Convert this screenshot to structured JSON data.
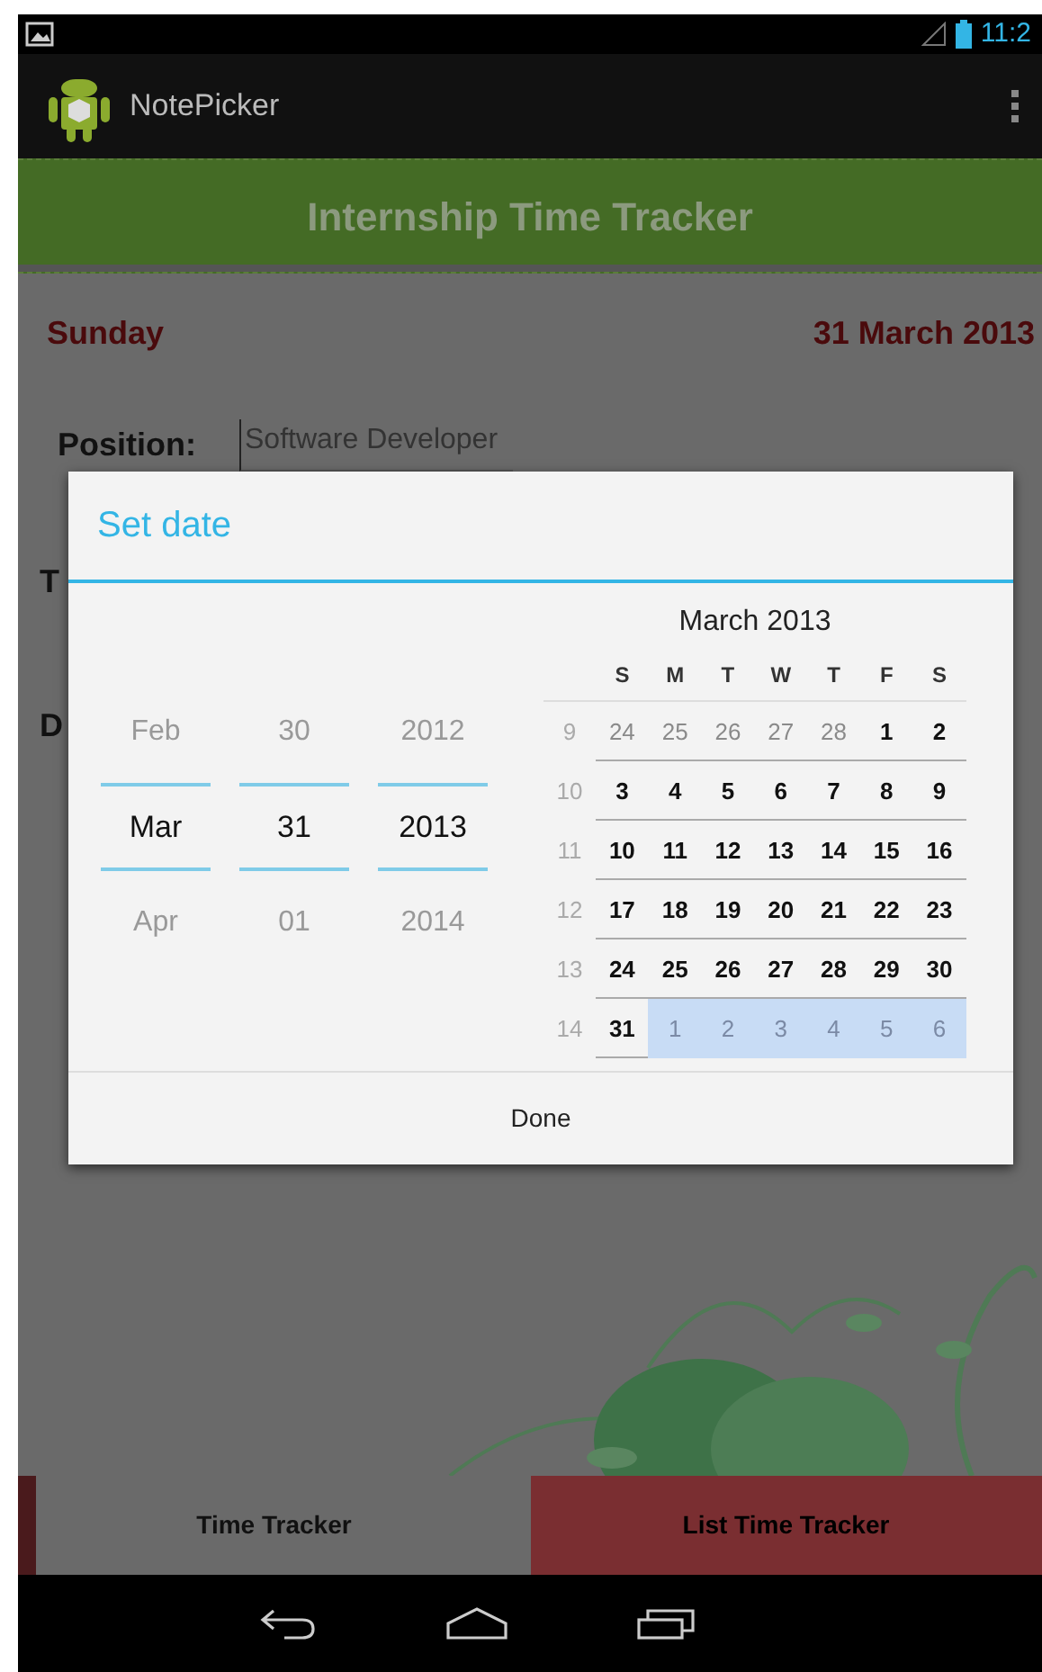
{
  "status_bar": {
    "time": "11:2"
  },
  "action_bar": {
    "title": "NotePicker"
  },
  "banner": {
    "title": "Internship Time Tracker"
  },
  "content": {
    "day": "Sunday",
    "date": "31 March 2013",
    "position_label": "Position:",
    "position_value": "Software Developer",
    "hidden_labels": [
      "T",
      "D"
    ]
  },
  "dialog": {
    "title": "Set date",
    "spinners": [
      {
        "prev": "Feb",
        "current": "Mar",
        "next": "Apr"
      },
      {
        "prev": "30",
        "current": "31",
        "next": "01"
      },
      {
        "prev": "2012",
        "current": "2013",
        "next": "2014"
      }
    ],
    "calendar": {
      "month": "March 2013",
      "weekdays": [
        "S",
        "M",
        "T",
        "W",
        "T",
        "F",
        "S"
      ],
      "weeks": [
        {
          "number": "9",
          "days": [
            {
              "day": "24",
              "muted": true,
              "shaded": false
            },
            {
              "day": "25",
              "muted": true,
              "shaded": false
            },
            {
              "day": "26",
              "muted": true,
              "shaded": false
            },
            {
              "day": "27",
              "muted": true,
              "shaded": false
            },
            {
              "day": "28",
              "muted": true,
              "shaded": false
            },
            {
              "day": "1",
              "muted": false,
              "shaded": false
            },
            {
              "day": "2",
              "muted": false,
              "shaded": false
            }
          ]
        },
        {
          "number": "10",
          "days": [
            {
              "day": "3",
              "muted": false,
              "shaded": false
            },
            {
              "day": "4",
              "muted": false,
              "shaded": false
            },
            {
              "day": "5",
              "muted": false,
              "shaded": false
            },
            {
              "day": "6",
              "muted": false,
              "shaded": false
            },
            {
              "day": "7",
              "muted": false,
              "shaded": false
            },
            {
              "day": "8",
              "muted": false,
              "shaded": false
            },
            {
              "day": "9",
              "muted": false,
              "shaded": false
            }
          ]
        },
        {
          "number": "11",
          "days": [
            {
              "day": "10",
              "muted": false,
              "shaded": false
            },
            {
              "day": "11",
              "muted": false,
              "shaded": false
            },
            {
              "day": "12",
              "muted": false,
              "shaded": false
            },
            {
              "day": "13",
              "muted": false,
              "shaded": false
            },
            {
              "day": "14",
              "muted": false,
              "shaded": false
            },
            {
              "day": "15",
              "muted": false,
              "shaded": false
            },
            {
              "day": "16",
              "muted": false,
              "shaded": false
            }
          ]
        },
        {
          "number": "12",
          "days": [
            {
              "day": "17",
              "muted": false,
              "shaded": false
            },
            {
              "day": "18",
              "muted": false,
              "shaded": false
            },
            {
              "day": "19",
              "muted": false,
              "shaded": false
            },
            {
              "day": "20",
              "muted": false,
              "shaded": false
            },
            {
              "day": "21",
              "muted": false,
              "shaded": false
            },
            {
              "day": "22",
              "muted": false,
              "shaded": false
            },
            {
              "day": "23",
              "muted": false,
              "shaded": false
            }
          ]
        },
        {
          "number": "13",
          "days": [
            {
              "day": "24",
              "muted": false,
              "shaded": false
            },
            {
              "day": "25",
              "muted": false,
              "shaded": false
            },
            {
              "day": "26",
              "muted": false,
              "shaded": false
            },
            {
              "day": "27",
              "muted": false,
              "shaded": false
            },
            {
              "day": "28",
              "muted": false,
              "shaded": false
            },
            {
              "day": "29",
              "muted": false,
              "shaded": false
            },
            {
              "day": "30",
              "muted": false,
              "shaded": false
            }
          ]
        },
        {
          "number": "14",
          "days": [
            {
              "day": "31",
              "muted": false,
              "shaded": false
            },
            {
              "day": "1",
              "muted": true,
              "shaded": true
            },
            {
              "day": "2",
              "muted": true,
              "shaded": true
            },
            {
              "day": "3",
              "muted": true,
              "shaded": true
            },
            {
              "day": "4",
              "muted": true,
              "shaded": true
            },
            {
              "day": "5",
              "muted": true,
              "shaded": true
            },
            {
              "day": "6",
              "muted": true,
              "shaded": true
            }
          ]
        }
      ]
    },
    "button": "Done"
  },
  "tabs": [
    {
      "label": "Time Tracker",
      "selected": true
    },
    {
      "label": "List Time Tracker",
      "selected": false
    }
  ]
}
